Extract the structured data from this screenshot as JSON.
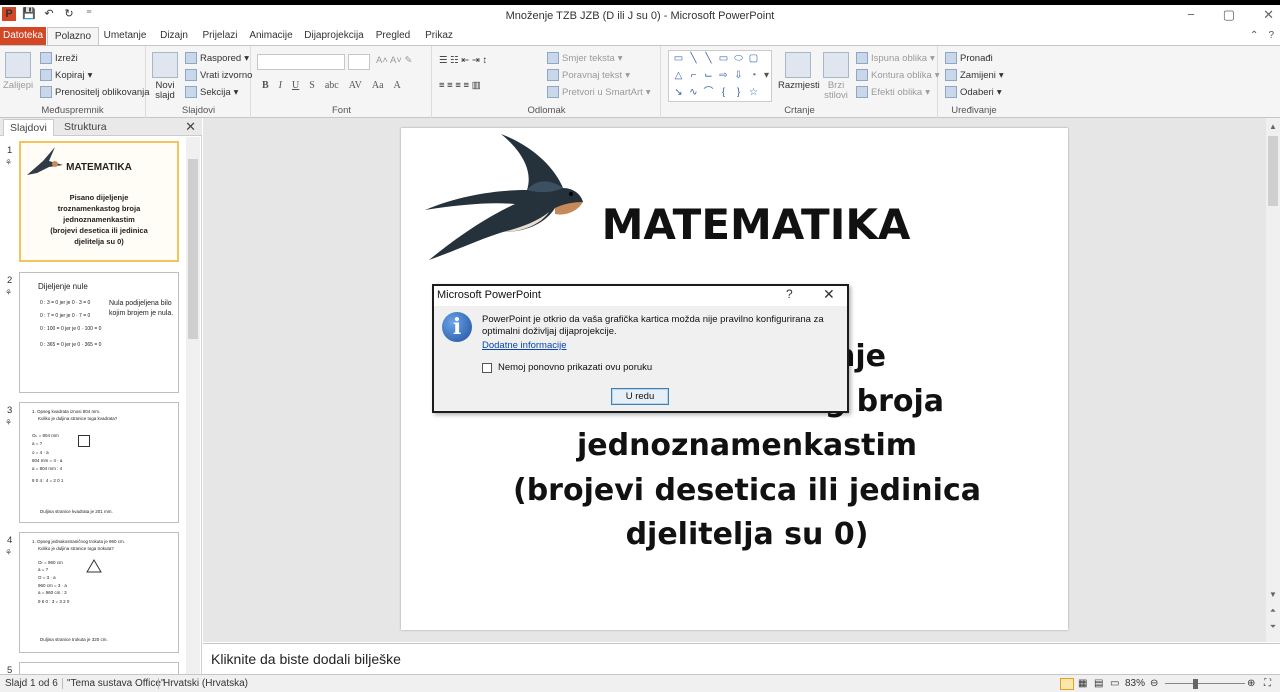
{
  "window": {
    "title": "Množenje TZB JZB (D ili J su 0)  -  Microsoft PowerPoint"
  },
  "quick_access": {
    "logo": "P",
    "save": "💾",
    "undo": "↶",
    "redo": "↻",
    "customize": "⁼"
  },
  "window_controls": {
    "minimize": "−",
    "maximize": "▢",
    "close": "✕"
  },
  "tabs": [
    "Datoteka",
    "Polazno",
    "Umetanje",
    "Dizajn",
    "Prijelazi",
    "Animacije",
    "Dijaprojekcija",
    "Pregled",
    "Prikaz"
  ],
  "ribbon": {
    "clipboard": {
      "label": "Međuspremnik",
      "paste": "Zalijepi",
      "cut": "Izreži",
      "copy": "Kopiraj",
      "format_painter": "Prenositelj oblikovanja"
    },
    "slides": {
      "label": "Slajdovi",
      "new_slide": "Novi slajd",
      "layout": "Raspored",
      "reset": "Vrati izvorno",
      "section": "Sekcija"
    },
    "font": {
      "label": "Font"
    },
    "paragraph": {
      "label": "Odlomak",
      "text_direction": "Smjer teksta",
      "align_text": "Poravnaj tekst",
      "smartart": "Pretvori u SmartArt"
    },
    "drawing": {
      "label": "Crtanje",
      "arrange": "Razmjesti",
      "quick_styles": "Brzi stilovi",
      "shape_fill": "Ispuna oblika",
      "shape_outline": "Kontura oblika",
      "shape_effects": "Efekti oblika"
    },
    "editing": {
      "label": "Uređivanje",
      "find": "Pronađi",
      "replace": "Zamijeni",
      "select": "Odaberi"
    }
  },
  "panel": {
    "tab_slides": "Slajdovi",
    "tab_outline": "Struktura",
    "close": "✕"
  },
  "thumbnails": [
    {
      "num": "1",
      "title": "MATEMATIKA",
      "lines": [
        "Pisano dijeljenje",
        "troznamenkastog broja",
        "jednoznamenkastim",
        "(brojevi desetica ili jedinica",
        "djelitelja su 0)"
      ]
    },
    {
      "num": "2",
      "title": "Dijeljenje nule",
      "lines": [
        "0 : 3 = 0  jer je 0 · 3 = 0",
        "0 : 7 = 0  jer je 0 · 7 = 0",
        "0 : 100 = 0  jer je 0 · 100 = 0",
        "0 : 365 = 0  jer je 0 · 365 = 0"
      ],
      "note": "Nula podijeljena bilo kojim brojem je nula."
    },
    {
      "num": "3",
      "lines": [
        "1. Opseg kvadrata iznosi 804 mm.",
        "Koliko je duljina stranice toga kvadrata?",
        "Oₖ = 804 mm",
        "a = ?",
        "o = 4 · a",
        "804 mm = 4 · a",
        "a = 804 mm : 4",
        "8 0 4 : 4 = 2 0 1",
        "Duljina stranice kvadrata je 201 mm."
      ]
    },
    {
      "num": "4",
      "lines": [
        "1. Opseg jednakostraničnog trokuta je 960 cm.",
        "Koliko je duljina stranice toga trokuta?",
        "Oₜ = 960 cm",
        "a = ?",
        "O = 3 · a",
        "960 cm = 3 · a",
        "a = 960 cm : 3",
        "9 6 0 : 3 = 3 2 0",
        "Duljina stranice trokuta je 320 cm."
      ]
    },
    {
      "num": "5"
    }
  ],
  "slide": {
    "title": "MATEMATIKA",
    "body": [
      "Pisano dijeljenje",
      "troznamenkastog broja",
      "jednoznamenkastim",
      "(brojevi desetica ili jedinica",
      "djelitelja su 0)"
    ]
  },
  "notes": {
    "placeholder": "Kliknite da biste dodali bilješke"
  },
  "status": {
    "slide": "Slajd 1 od 6",
    "theme": "\"Tema sustava Office\"",
    "language": "Hrvatski (Hrvatska)",
    "zoom": "83%"
  },
  "dialog": {
    "title": "Microsoft PowerPoint",
    "help": "?",
    "close": "✕",
    "icon": "i",
    "message": "PowerPoint je otkrio da vaša grafička kartica možda nije pravilno konfigurirana za optimalni doživljaj dijaprojekcije.",
    "link": "Dodatne informacije",
    "checkbox": "Nemoj ponovno prikazati ovu poruku",
    "ok": "U redu"
  },
  "colors": {
    "accent": "#d24726",
    "selection": "#f3c45c",
    "link": "#0645ad"
  }
}
